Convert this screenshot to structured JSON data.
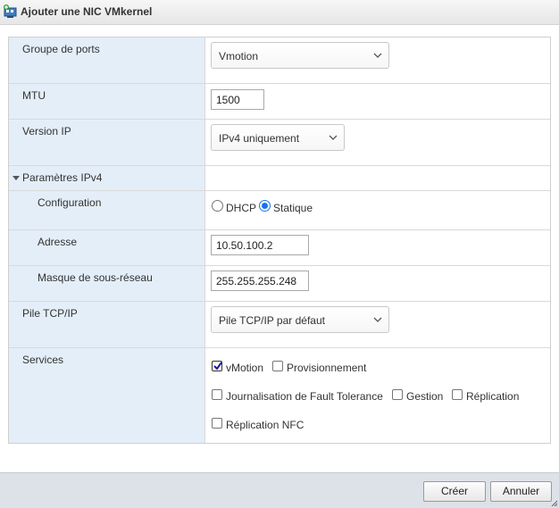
{
  "dialog": {
    "title": "Ajouter une NIC VMkernel"
  },
  "fields": {
    "port_group": {
      "label": "Groupe de ports",
      "value": "Vmotion"
    },
    "mtu": {
      "label": "MTU",
      "value": "1500"
    },
    "ip_version": {
      "label": "Version IP",
      "value": "IPv4 uniquement"
    },
    "ipv4_section": {
      "label": "Paramètres IPv4"
    },
    "configuration": {
      "label": "Configuration",
      "options": [
        {
          "label": "DHCP",
          "selected": false
        },
        {
          "label": "Statique",
          "selected": true
        }
      ]
    },
    "address": {
      "label": "Adresse",
      "value": "10.50.100.2"
    },
    "subnet_mask": {
      "label": "Masque de sous-réseau",
      "value": "255.255.255.248"
    },
    "tcp_stack": {
      "label": "Pile TCP/IP",
      "value": "Pile TCP/IP par défaut"
    },
    "services": {
      "label": "Services",
      "options": [
        {
          "label": "vMotion",
          "checked": true
        },
        {
          "label": "Provisionnement",
          "checked": false
        },
        {
          "label": "Journalisation de Fault Tolerance",
          "checked": false
        },
        {
          "label": "Gestion",
          "checked": false
        },
        {
          "label": "Réplication",
          "checked": false
        },
        {
          "label": "Réplication NFC",
          "checked": false
        }
      ]
    }
  },
  "footer": {
    "create_label": "Créer",
    "cancel_label": "Annuler"
  },
  "colors": {
    "label_bg": "#e4eef8",
    "footer_bg": "#dde2e8",
    "radio_accent": "#1a73e8"
  },
  "icons": {
    "title": "network-adapter-add-icon",
    "select": "chevron-down-icon",
    "section": "caret-down-icon"
  }
}
